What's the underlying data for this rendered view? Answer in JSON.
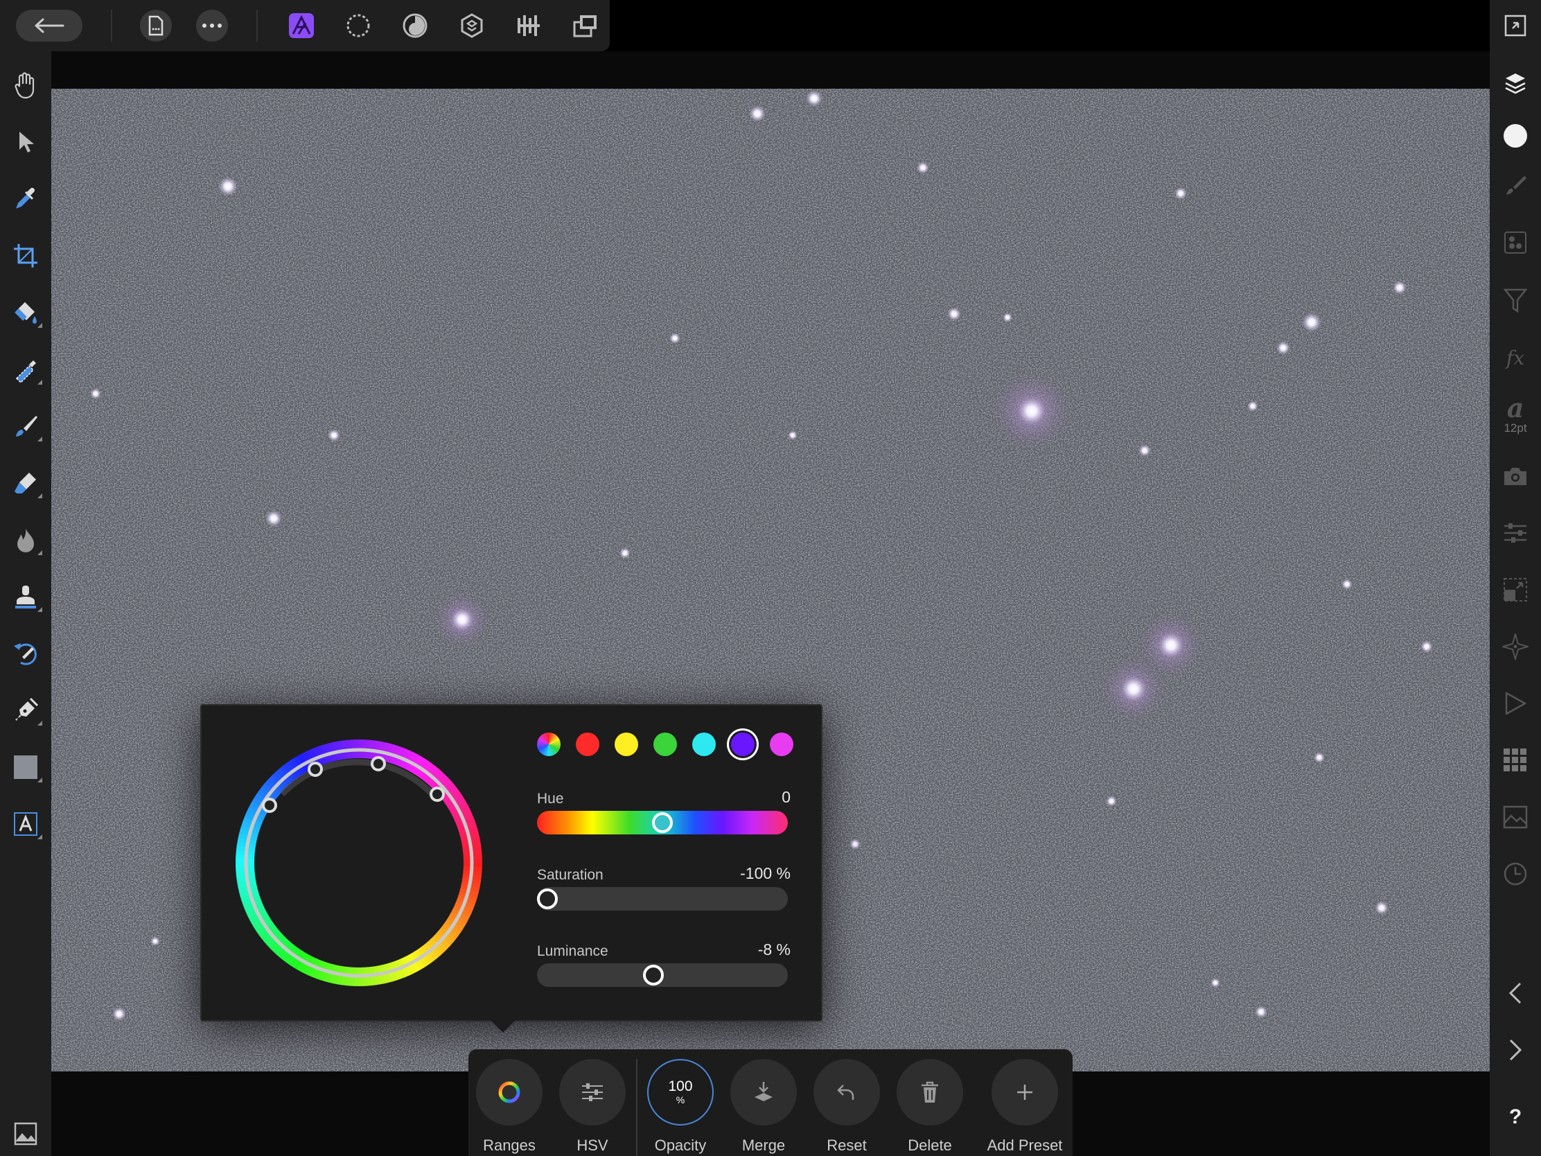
{
  "topbar": {
    "icons": [
      "back-arrow-icon",
      "document-icon",
      "more-icon",
      "photo-persona-icon",
      "liquify-persona-icon",
      "develop-persona-icon",
      "tone-mapping-persona-icon",
      "export-persona-icon",
      "layout-icon"
    ]
  },
  "left_toolbar": {
    "tools": [
      "hand-tool",
      "move-tool",
      "color-picker-tool",
      "crop-tool",
      "flood-fill-tool",
      "selection-brush-tool",
      "paint-brush-tool",
      "erase-brush-tool",
      "burn-tool",
      "clone-tool",
      "undo-brush-tool",
      "pen-tool",
      "rectangle-tool",
      "artistic-text-tool"
    ]
  },
  "right_toolbar": {
    "text_style_size": "12pt"
  },
  "hsl_panel": {
    "swatch_colors": [
      "#ff2a2a",
      "#ffee22",
      "#3bd43b",
      "#2ee8f0",
      "#6a16ff",
      "#e83cf0"
    ],
    "hue": {
      "label": "Hue",
      "value": "0",
      "level": 0.5
    },
    "saturation": {
      "label": "Saturation",
      "value": "-100 %",
      "level": 0.0
    },
    "luminance": {
      "label": "Luminance",
      "value": "-8 %",
      "level": 0.46
    }
  },
  "bottom_bar": {
    "ranges": "Ranges",
    "hsv": "HSV",
    "opacity_label": "Opacity",
    "opacity_value": "100",
    "opacity_unit": "%",
    "merge": "Merge",
    "reset": "Reset",
    "delete": "Delete",
    "add_preset": "Add Preset"
  }
}
